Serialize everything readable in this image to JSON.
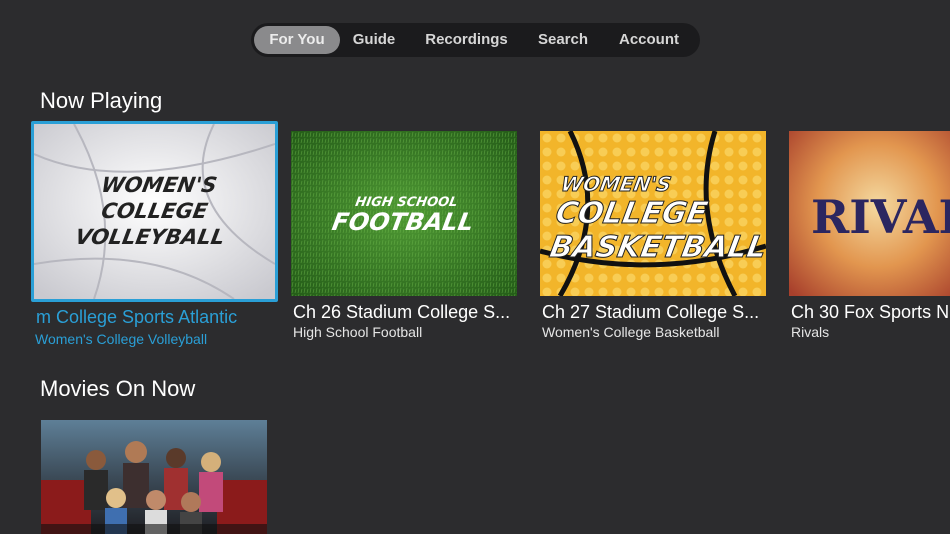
{
  "nav": {
    "items": [
      {
        "label": "For You",
        "active": true
      },
      {
        "label": "Guide",
        "active": false
      },
      {
        "label": "Recordings",
        "active": false
      },
      {
        "label": "Search",
        "active": false
      },
      {
        "label": "Account",
        "active": false
      }
    ]
  },
  "now_playing": {
    "title": "Now Playing",
    "cards": [
      {
        "art": "WOMEN'S COLLEGE VOLLEYBALL",
        "channel": "m College Sports Atlantic",
        "program": "Women's College Volleyball"
      },
      {
        "art": "HIGH SCHOOL FOOTBALL",
        "channel": "Ch 26 Stadium College S...",
        "program": "High School Football"
      },
      {
        "art": "WOMEN'S COLLEGE BASKETBALL",
        "channel": "Ch 27 Stadium College S...",
        "program": "Women's College Basketball"
      },
      {
        "art": "RIVALS",
        "channel": "Ch 30 Fox Sports N",
        "program": "Rivals"
      }
    ]
  },
  "movies_on_now": {
    "title": "Movies On Now"
  },
  "colors": {
    "focus": "#2a9fd6",
    "background": "#2c2c2e"
  }
}
